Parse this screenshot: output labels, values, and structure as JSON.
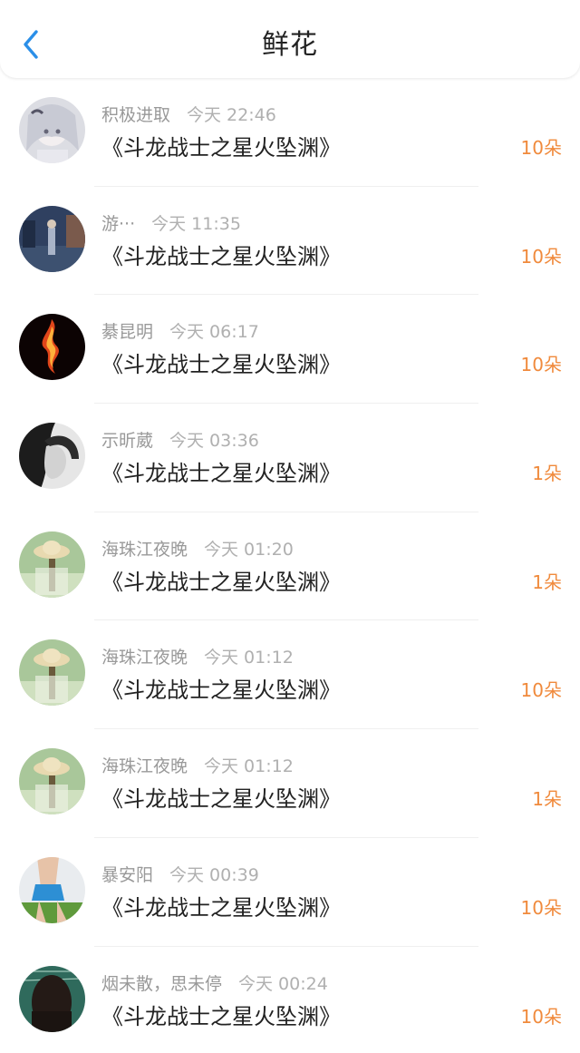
{
  "header": {
    "title": "鲜花",
    "back_icon": "chevron-left-icon",
    "accent": "#2b8fe8"
  },
  "colors": {
    "count": "#f08a3c",
    "meta": "#999999",
    "time": "#b0b0b0"
  },
  "items": [
    {
      "user": "积极进取",
      "time": "今天 22:46",
      "book": "《斗龙战士之星火坠渊》",
      "count": "10朵"
    },
    {
      "user": "游···",
      "time": "今天 11:35",
      "book": "《斗龙战士之星火坠渊》",
      "count": "10朵"
    },
    {
      "user": "綦昆明",
      "time": "今天 06:17",
      "book": "《斗龙战士之星火坠渊》",
      "count": "10朵"
    },
    {
      "user": "示昕葳",
      "time": "今天 03:36",
      "book": "《斗龙战士之星火坠渊》",
      "count": "1朵"
    },
    {
      "user": "海珠江夜晚",
      "time": "今天 01:20",
      "book": "《斗龙战士之星火坠渊》",
      "count": "1朵"
    },
    {
      "user": "海珠江夜晚",
      "time": "今天 01:12",
      "book": "《斗龙战士之星火坠渊》",
      "count": "10朵"
    },
    {
      "user": "海珠江夜晚",
      "time": "今天 01:12",
      "book": "《斗龙战士之星火坠渊》",
      "count": "1朵"
    },
    {
      "user": "暴安阳",
      "time": "今天 00:39",
      "book": "《斗龙战士之星火坠渊》",
      "count": "10朵"
    },
    {
      "user": "烟未散，思未停",
      "time": "今天 00:24",
      "book": "《斗龙战士之星火坠渊》",
      "count": "10朵"
    }
  ]
}
